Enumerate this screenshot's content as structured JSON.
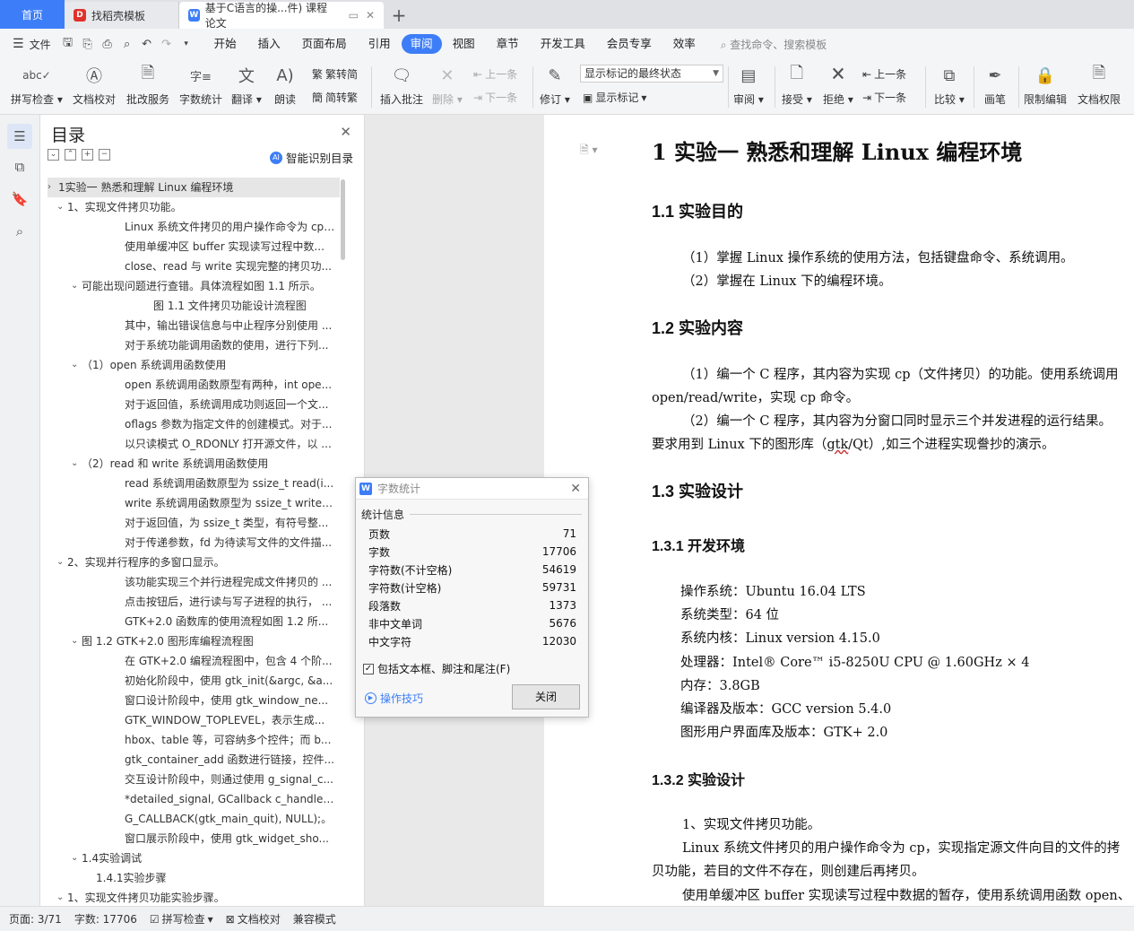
{
  "tabs": {
    "home": "首页",
    "find_template": "找稻壳模板",
    "document": "基于C语言的操...件)  课程论文"
  },
  "menu": {
    "file": "文件",
    "items": [
      "开始",
      "插入",
      "页面布局",
      "引用",
      "审阅",
      "视图",
      "章节",
      "开发工具",
      "会员专享",
      "效率"
    ],
    "active": "审阅",
    "search": "查找命令、搜索模板"
  },
  "ribbon": {
    "spell_check": "拼写检查",
    "doc_proof": "文档校对",
    "batch_review": "批改服务",
    "word_count": "字数统计",
    "translate": "翻译",
    "read_aloud": "朗读",
    "trad_conv": "繁转简",
    "simp_conv": "简转繁",
    "insert_comment": "插入批注",
    "delete": "删除",
    "prev_comment": "上一条",
    "next_comment": "下一条",
    "revise": "修订",
    "markup_mode": "显示标记的最终状态",
    "show_markup": "显示标记",
    "review": "审阅",
    "accept": "接受",
    "reject": "拒绝",
    "prev_change": "上一条",
    "next_change": "下一条",
    "compare": "比较",
    "pen": "画笔",
    "restrict_edit": "限制编辑",
    "doc_permission": "文档权限"
  },
  "toc": {
    "title": "目录",
    "smart": "智能识别目录",
    "items": [
      {
        "text": "1实验一 熟悉和理解 Linux 编程环境",
        "level": 0,
        "chev": "›",
        "selected": true
      },
      {
        "text": "1、实现文件拷贝功能。",
        "level": 1,
        "chev": "⌄"
      },
      {
        "text": "Linux 系统文件拷贝的用户操作命令为 cp ...",
        "level": 4
      },
      {
        "text": "使用单缓冲区 buffer 实现读写过程中数...",
        "level": 4
      },
      {
        "text": "close、read 与 write 实现完整的拷贝功...",
        "level": 4
      },
      {
        "text": "可能出现问题进行查错。具体流程如图 1.1 所示。",
        "level": 2,
        "chev": "⌄"
      },
      {
        "text": "图 1.1 文件拷贝功能设计流程图",
        "level": 5
      },
      {
        "text": "其中，输出错误信息与中止程序分别使用 ...",
        "level": 4
      },
      {
        "text": "对于系统功能调用函数的使用，进行下列...",
        "level": 4
      },
      {
        "text": "（1）open 系统调用函数使用",
        "level": 2,
        "chev": "⌄"
      },
      {
        "text": "open 系统调用函数原型有两种，int ope...",
        "level": 4
      },
      {
        "text": "对于返回值，系统调用成功则返回一个文...",
        "level": 4
      },
      {
        "text": "oflags 参数为指定文件的创建模式。对于...",
        "level": 4
      },
      {
        "text": "以只读模式 O_RDONLY 打开源文件，以 ...",
        "level": 4
      },
      {
        "text": "（2）read 和 write 系统调用函数使用",
        "level": 2,
        "chev": "⌄"
      },
      {
        "text": "read 系统调用函数原型为 ssize_t read(i...",
        "level": 4
      },
      {
        "text": "write 系统调用函数原型为 ssize_t write(i...",
        "level": 4
      },
      {
        "text": "对于返回值，为 ssize_t 类型，有符号整...",
        "level": 4
      },
      {
        "text": "对于传递参数，fd 为待读写文件的文件描...",
        "level": 4
      },
      {
        "text": "2、实现并行程序的多窗口显示。",
        "level": 1,
        "chev": "⌄"
      },
      {
        "text": "该功能实现三个并行进程完成文件拷贝的 ...",
        "level": 4
      },
      {
        "text": "点击按钮后，进行读与写子进程的执行， ...",
        "level": 4
      },
      {
        "text": "GTK+2.0 函数库的使用流程如图 1.2 所...",
        "level": 4
      },
      {
        "text": "图 1.2 GTK+2.0 图形库编程流程图",
        "level": 2,
        "chev": "⌄"
      },
      {
        "text": "在 GTK+2.0 编程流程图中，包含 4 个阶...",
        "level": 4
      },
      {
        "text": "初始化阶段中，使用 gtk_init(&argc, &a...",
        "level": 4
      },
      {
        "text": "窗口设计阶段中，使用 gtk_window_ne...",
        "level": 4
      },
      {
        "text": "GTK_WINDOW_TOPLEVEL，表示生成...",
        "level": 4
      },
      {
        "text": "hbox、table 等，可容纳多个控件；而 b...",
        "level": 4
      },
      {
        "text": "gtk_container_add 函数进行链接，控件...",
        "level": 4
      },
      {
        "text": "交互设计阶段中，则通过使用 g_signal_c...",
        "level": 4
      },
      {
        "text": "*detailed_signal, GCallback c_handler, ...",
        "level": 4
      },
      {
        "text": "G_CALLBACK(gtk_main_quit), NULL);。",
        "level": 4
      },
      {
        "text": "窗口展示阶段中，使用 gtk_widget_sho...",
        "level": 4
      },
      {
        "text": "1.4实验调试",
        "level": 2,
        "chev": "⌄"
      },
      {
        "text": "1.4.1实验步骤",
        "level": 3
      },
      {
        "text": "1、实现文件拷贝功能实验步骤。",
        "level": 1,
        "chev": "⌄"
      }
    ]
  },
  "doc": {
    "h1": "1  实验一  熟悉和理解  Linux  编程环境",
    "s11": "1.1  实验目的",
    "s11_p1": "（1）掌握  Linux 操作系统的使用方法，包括键盘命令、系统调用。",
    "s11_p2": "（2）掌握在  Linux 下的编程环境。",
    "s12": "1.2  实验内容",
    "s12_p1": "（1）编一个  C 程序，其内容为实现  cp（文件拷贝）的功能。使用系统调用",
    "s12_p2": "open/read/write，实现  cp 命令。",
    "s12_p3": "（2）编一个  C 程序，其内容为分窗口同时显示三个并发进程的运行结果。",
    "s12_p4a": "要求用到  Linux 下的图形库（",
    "s12_p4b": "gtk",
    "s12_p4c": "/Qt）,如三个进程实现誊抄的演示。",
    "s13": "1.3  实验设计",
    "s131": "1.3.1    开发环境",
    "env": [
      "操作系统：Ubuntu 16.04 LTS",
      "系统类型：64 位",
      "系统内核：Linux version 4.15.0",
      "处理器：Intel® Core™  i5-8250U CPU @ 1.60GHz ×  4",
      "内存：3.8GB",
      "编译器及版本：GCC version 5.4.0",
      "图形用户界面库及版本：GTK+ 2.0"
    ],
    "s132": "1.3.2    实验设计",
    "d1": "1、实现文件拷贝功能。",
    "d2": "Linux 系统文件拷贝的用户操作命令为  cp，实现指定源文件向目的文件的拷",
    "d3": "贝功能，若目的文件不存在，则创建后再拷贝。",
    "d4": "使用单缓冲区  buffer 实现读写过程中数据的暂存，使用系统调用函数  open、"
  },
  "dialog": {
    "title": "字数统计",
    "group": "统计信息",
    "rows": [
      {
        "label": "页数",
        "value": "71"
      },
      {
        "label": "字数",
        "value": "17706"
      },
      {
        "label": "字符数(不计空格)",
        "value": "54619"
      },
      {
        "label": "字符数(计空格)",
        "value": "59731"
      },
      {
        "label": "段落数",
        "value": "1373"
      },
      {
        "label": "非中文单词",
        "value": "5676"
      },
      {
        "label": "中文字符",
        "value": "12030"
      }
    ],
    "include_label": "包括文本框、脚注和尾注(F)",
    "include_checked": true,
    "tips": "操作技巧",
    "close": "关闭"
  },
  "status": {
    "page": "页面: 3/71",
    "words": "字数: 17706",
    "spell": "拼写检查",
    "proof": "文档校对",
    "compat": "兼容模式"
  }
}
